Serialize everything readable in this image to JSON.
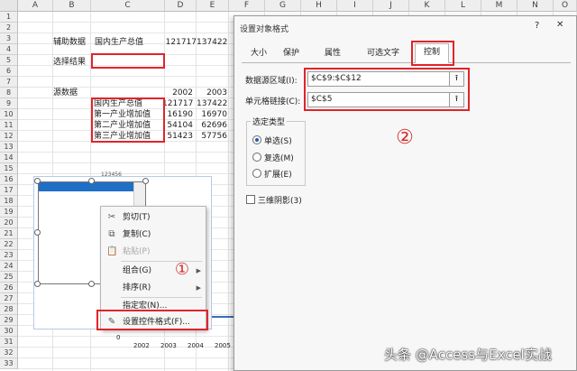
{
  "columns": [
    "A",
    "B",
    "C",
    "D",
    "E",
    "F",
    "G",
    "H",
    "I",
    "J",
    "K",
    "L",
    "M",
    "N",
    "O"
  ],
  "rows": [
    "1",
    "2",
    "3",
    "4",
    "5",
    "6",
    "7",
    "8",
    "9",
    "10",
    "11",
    "12",
    "13",
    "14",
    "15",
    "16",
    "17",
    "18",
    "19",
    "20",
    "21",
    "22",
    "23",
    "24",
    "25",
    "26",
    "27",
    "28",
    "29",
    "30",
    "31",
    "32",
    "33"
  ],
  "sheet": {
    "aux_label": "辅助数据",
    "aux_name": "国内生产总值",
    "aux_v1": "121717",
    "aux_v2": "137422",
    "select_label": "选择结果",
    "source_label": "源数据",
    "year1": "2002",
    "year2": "2003",
    "items": [
      {
        "name": "国内生产总值",
        "v1": "121717",
        "v2": "137422"
      },
      {
        "name": "第一产业增加值",
        "v1": "16190",
        "v2": "16970"
      },
      {
        "name": "第二产业增加值",
        "v1": "54104",
        "v2": "62696"
      },
      {
        "name": "第三产业增加值",
        "v1": "51423",
        "v2": "57756"
      }
    ]
  },
  "chart": {
    "axis_zero": "0",
    "x_ticks": [
      "2002",
      "2003",
      "2004",
      "2005"
    ],
    "fragment_text": "123456"
  },
  "context_menu": {
    "items": [
      {
        "label": "剪切(T)",
        "icon": "scissors-icon",
        "glyph": "✂",
        "disabled": false,
        "submenu": false
      },
      {
        "label": "复制(C)",
        "icon": "copy-icon",
        "glyph": "⧉",
        "disabled": false,
        "submenu": false
      },
      {
        "label": "粘贴(P)",
        "icon": "paste-icon",
        "glyph": "📋",
        "disabled": true,
        "submenu": false
      },
      {
        "label": "组合(G)",
        "icon": "",
        "glyph": "",
        "disabled": false,
        "submenu": true
      },
      {
        "label": "排序(R)",
        "icon": "",
        "glyph": "",
        "disabled": false,
        "submenu": true
      },
      {
        "label": "指定宏(N)...",
        "icon": "",
        "glyph": "",
        "disabled": false,
        "submenu": false
      },
      {
        "label": "设置控件格式(F)...",
        "icon": "format-control-icon",
        "glyph": "✎",
        "disabled": false,
        "submenu": false
      }
    ]
  },
  "annotations": {
    "one": "①",
    "two": "②"
  },
  "dialog": {
    "title": "设置对象格式",
    "help": "?",
    "close": "✕",
    "tabs": [
      "大小",
      "保护",
      "属性",
      "可选文字",
      "控制"
    ],
    "active_tab": "控制",
    "range_label": "数据源区域(I):",
    "range_value": "$C$9:$C$12",
    "link_label": "单元格链接(C):",
    "link_value": "$C$5",
    "picker_glyph": "⭱",
    "group_label": "选定类型",
    "radio_single": "单选(S)",
    "radio_multi": "复选(M)",
    "radio_extend": "扩展(E)",
    "shadow_label": "三维阴影(3)"
  },
  "watermark": "头条 @Access与Excel实战",
  "colors": {
    "accent_red": "#e0242b",
    "blue_bar": "#1f6fc5",
    "selection_blue": "#1f5fa8"
  }
}
